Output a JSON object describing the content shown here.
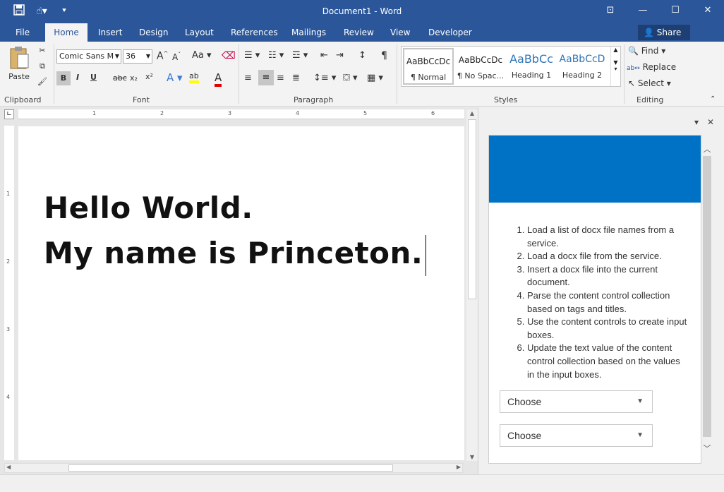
{
  "titlebar": {
    "title": "Document1 - Word",
    "qat": {
      "save_icon": "save-icon",
      "touch_icon": "touch-mode-icon",
      "customize_icon": "customize-qat-icon"
    },
    "window_buttons": {
      "restore_ribbon": "⊡",
      "minimize": "—",
      "maximize": "☐",
      "close": "✕"
    }
  },
  "tabs": [
    "File",
    "Home",
    "Insert",
    "Design",
    "Layout",
    "References",
    "Mailings",
    "Review",
    "View",
    "Developer"
  ],
  "active_tab": "Home",
  "share_label": "Share",
  "ribbon": {
    "clipboard": {
      "label": "Clipboard",
      "paste": "Paste"
    },
    "font": {
      "label": "Font",
      "font_name": "Comic Sans M",
      "font_size": "36",
      "grow": "A",
      "shrink": "A",
      "case": "Aa",
      "bold": "B",
      "italic": "I",
      "underline": "U",
      "strike": "abc",
      "subscript": "x₂",
      "superscript": "x²",
      "effects": "A",
      "highlight": "ab",
      "font_color": "A"
    },
    "paragraph": {
      "label": "Paragraph",
      "pilcrow": "¶"
    },
    "styles": {
      "label": "Styles",
      "items": [
        {
          "sample": "AaBbCcDc",
          "name": "¶ Normal"
        },
        {
          "sample": "AaBbCcDc",
          "name": "¶ No Spac..."
        },
        {
          "sample": "AaBbCc",
          "name": "Heading 1"
        },
        {
          "sample": "AaBbCcD",
          "name": "Heading 2"
        }
      ]
    },
    "editing": {
      "label": "Editing",
      "find": "Find",
      "replace": "Replace",
      "select": "Select"
    }
  },
  "ruler": {
    "h_marks": [
      "1",
      "2",
      "3",
      "4",
      "5",
      "6"
    ],
    "v_marks": [
      "1",
      "2",
      "3",
      "4"
    ]
  },
  "document": {
    "lines": [
      "Hello World.",
      "My name is Princeton."
    ]
  },
  "taskpane": {
    "steps": [
      "Load a list of docx file names from a service.",
      "Load a docx file from the service.",
      "Insert a docx file into the current document.",
      "Parse the content control collection based on tags and titles.",
      "Use the content controls to create input boxes.",
      "Update the text value of the content control collection based on the values in the input boxes."
    ],
    "dropdown1": "Choose",
    "dropdown2": "Choose",
    "banner_color": "#0072c6"
  },
  "colors": {
    "title_bar": "#2b579a",
    "accent": "#2b579a"
  }
}
